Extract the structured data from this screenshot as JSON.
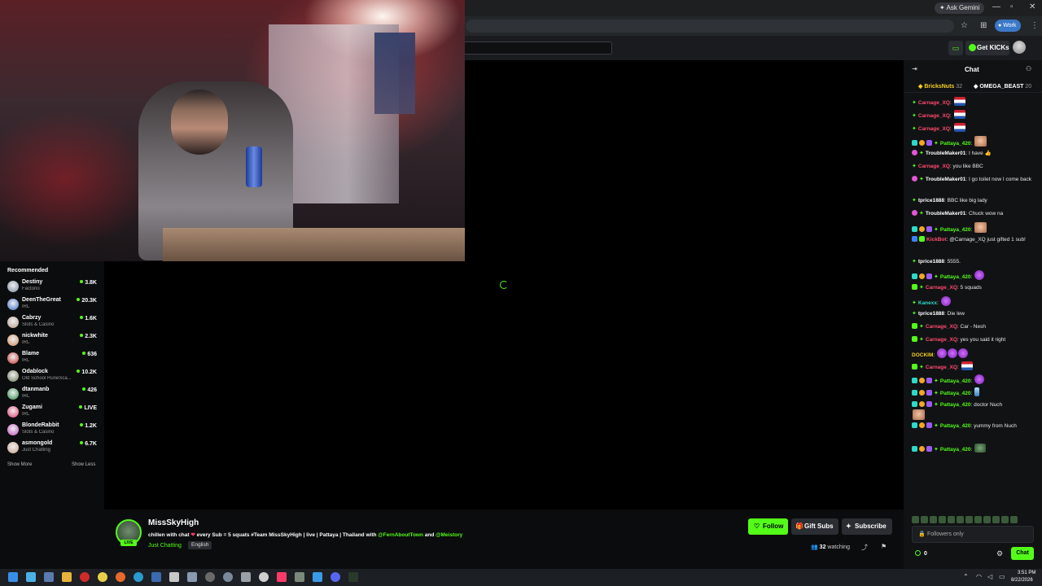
{
  "browser": {
    "ask_gemini": "Ask Gemini",
    "profile": "Work"
  },
  "nav": {
    "get_kicks": "Get KICKs"
  },
  "sidebar": {
    "title": "Recommended",
    "channels": [
      {
        "name": "Destiny",
        "category": "Factorio",
        "viewers": "3.8K",
        "color": "#7a8aa0"
      },
      {
        "name": "DeenTheGreat",
        "category": "IRL",
        "viewers": "20.3K",
        "color": "#3a6ac8"
      },
      {
        "name": "Cabrzy",
        "category": "Slots & Casino",
        "viewers": "1.6K",
        "color": "#b89a8a"
      },
      {
        "name": "nickwhite",
        "category": "IRL",
        "viewers": "2.3K",
        "color": "#d08a5a"
      },
      {
        "name": "Blame",
        "category": "IRL",
        "viewers": "636",
        "color": "#c03030"
      },
      {
        "name": "Odablock",
        "category": "Old School RuneSca...",
        "viewers": "10.2K",
        "color": "#6a7a5a"
      },
      {
        "name": "dtanmanb",
        "category": "IRL",
        "viewers": "426",
        "color": "#2a8a4a"
      },
      {
        "name": "Zugami",
        "category": "IRL",
        "viewers": "LIVE",
        "color": "#e03a6a"
      },
      {
        "name": "BlondeRabbit",
        "category": "Slots & Casino",
        "viewers": "1.2K",
        "color": "#c050c0"
      },
      {
        "name": "asmongold",
        "category": "Just Chatting",
        "viewers": "6.7K",
        "color": "#c8a08a"
      }
    ],
    "show_more": "Show More",
    "show_less": "Show Less"
  },
  "stream": {
    "channel": "MissSkyHigh",
    "live": "LIVE",
    "title_prefix": "chillen with chat",
    "title_middle": "every Sub = 5 squats #Team MissSkyHigh | live | Pattaya | Thailand with",
    "mention1": "@FernAboutTown",
    "title_and": "and",
    "mention2": "@Meistory",
    "category": "Just Chatting",
    "language": "English",
    "follow": "Follow",
    "gift_subs": "Gift Subs",
    "subscribe": "Subscribe",
    "viewers": "32",
    "watching": "watching"
  },
  "chat": {
    "title": "Chat",
    "pinned": [
      {
        "user": "BricksNuts",
        "count": "32"
      },
      {
        "user": "OMEGA_BEAST",
        "count": "20"
      }
    ],
    "messages": [
      {
        "user": "Carnage_XQ",
        "text": ""
      },
      {
        "user": "Carnage_XQ",
        "text": ""
      },
      {
        "user": "Carnage_XQ",
        "text": ""
      },
      {
        "user": "Pattaya_420",
        "text": ""
      },
      {
        "user": "TroubleMaker01",
        "text": "I have 👍"
      },
      {
        "user": "Carnage_XQ",
        "text": "you like BBC"
      },
      {
        "user": "TroubleMaker01",
        "text": "I go toilet now I come back"
      },
      {
        "user": "tprice1888",
        "text": "BBC like big lady"
      },
      {
        "user": "TroubleMaker01",
        "text": "Chuck wow na"
      },
      {
        "user": "Pattaya_420",
        "text": ""
      },
      {
        "user": "KickBot",
        "text": "@Carnage_XQ just gifted 1 sub!"
      },
      {
        "user": "tprice1888",
        "text": "5555."
      },
      {
        "user": "Pattaya_420",
        "text": ""
      },
      {
        "user": "Carnage_XQ",
        "text": "5 squads"
      },
      {
        "user": "Kanexx",
        "text": ""
      },
      {
        "user": "tprice1888",
        "text": "Die lew"
      },
      {
        "user": "Carnage_XQ",
        "text": "Car - Nesh"
      },
      {
        "user": "Carnage_XQ",
        "text": "yes you said it right"
      },
      {
        "user": "DOCKIM",
        "text": ""
      },
      {
        "user": "Carnage_XQ",
        "text": ""
      },
      {
        "user": "Pattaya_420",
        "text": ""
      },
      {
        "user": "Pattaya_420",
        "text": ""
      },
      {
        "user": "Pattaya_420",
        "text": "doctor Nuch"
      },
      {
        "user": "Pattaya_420",
        "text": "yummy from Nuch"
      },
      {
        "user": "Pattaya_420",
        "text": ""
      }
    ],
    "input_placeholder": "Followers only",
    "kicks": "0",
    "send": "Chat"
  },
  "taskbar": {
    "time": "3:51 PM",
    "date": "8/22/2026"
  },
  "colors": {
    "accent": "#53fc18",
    "chat_bg": "#111214",
    "red_user": "#ff4b6e"
  }
}
